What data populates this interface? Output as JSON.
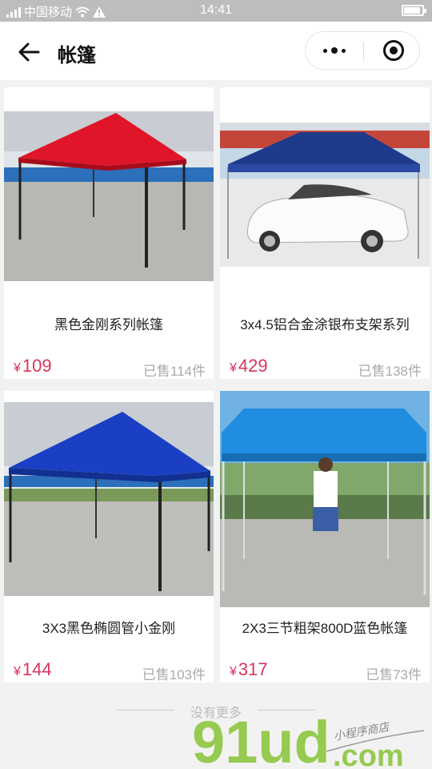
{
  "status_bar": {
    "carrier": "中国移动",
    "time": "14:41"
  },
  "nav": {
    "title": "帐篷"
  },
  "products": [
    {
      "title": "黑色金刚系列帐篷",
      "currency": "¥",
      "price": "109",
      "sold": "已售114件",
      "canopy_color": "#e0152a"
    },
    {
      "title": "3x4.5铝合金涂银布支架系列",
      "currency": "¥",
      "price": "429",
      "sold": "已售138件",
      "canopy_color": "#1e3a8a"
    },
    {
      "title": "3X3黑色椭圆管小金刚",
      "currency": "¥",
      "price": "144",
      "sold": "已售103件",
      "canopy_color": "#1a3fc4"
    },
    {
      "title": "2X3三节粗架800D蓝色帐篷",
      "currency": "¥",
      "price": "317",
      "sold": "已售73件",
      "canopy_color": "#1f8de0"
    }
  ],
  "footer": {
    "no_more": "没有更多"
  },
  "watermark": {
    "logo": "91ud",
    "tld": ".com",
    "tagline": "小程序商店"
  },
  "colors": {
    "price": "#d9345c",
    "status_bar": "#bdbdbd"
  }
}
